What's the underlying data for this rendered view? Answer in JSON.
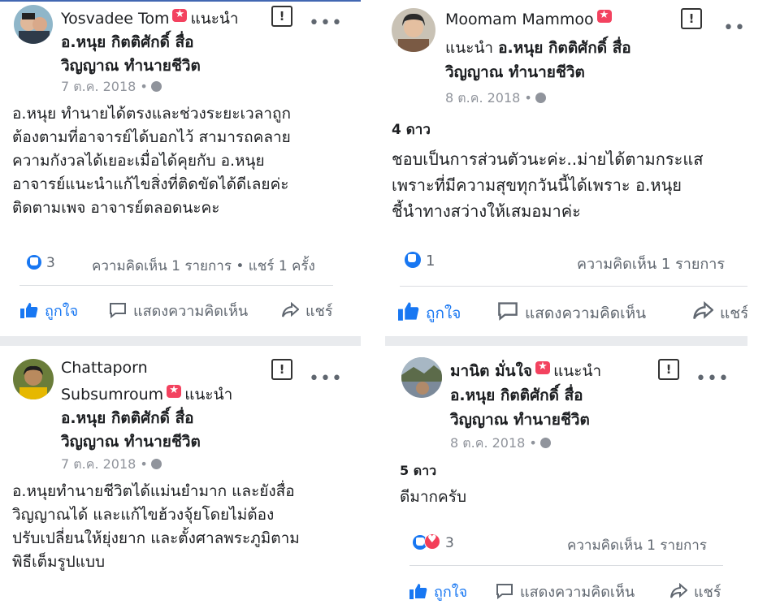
{
  "posts": [
    {
      "author": "Yosvadee Tom",
      "recommend_label": "แนะนำ",
      "page_line_1": "อ.หนุย กิตติศักดิ์ สื่อ",
      "page_line_2": "วิญญาณ ทำนายชีวิต",
      "date": "7 ต.ค. 2018 •",
      "stars": "",
      "body": [
        "อ.หนุย ทำนายได้ตรงและช่วงระยะเวลาถูก",
        "ต้องตามที่อาจารย์ได้บอกไว้ สามารถคลาย",
        "ความกังวลได้เยอะเมื่อได้คุยกับ อ.หนุย",
        "อาจารย์แนะนำแก้ไขสิ่งที่ติดขัดได้ดีเลยค่ะ",
        "ติดตามเพจ อาจารย์ตลอดนะคะ"
      ],
      "reaction_count": "3",
      "summary": "ความคิดเห็น 1 รายการ • แชร์ 1 ครั้ง",
      "like_label": "ถูกใจ",
      "comment_label": "แสดงความคิดเห็น",
      "share_label": "แชร์"
    },
    {
      "author": "Moomam Mammoo",
      "recommend_label": "แนะนำ",
      "page_line_1": "อ.หนุย กิตติศักดิ์ สื่อ",
      "page_line_2": "วิญญาณ ทำนายชีวิต",
      "date": "8 ต.ค. 2018 •",
      "stars": "4 ดาว",
      "body": [
        "ชอบเป็นการส่วนตัวนะค่ะ..ม่ายได้ตามกระแส",
        "เพราะที่มีความสุขทุกวันนี้ได้เพราะ อ.หนุย",
        "ชี้นำทางสว่างให้เสมอมาค่ะ"
      ],
      "reaction_count": "1",
      "summary": "ความคิดเห็น 1 รายการ",
      "like_label": "ถูกใจ",
      "comment_label": "แสดงความคิดเห็น",
      "share_label": "แชร์"
    },
    {
      "author_line_1": "Chattaporn",
      "author_line_2": "Subsumroum",
      "recommend_label": "แนะนำ",
      "page_line_1": "อ.หนุย กิตติศักดิ์ สื่อ",
      "page_line_2": "วิญญาณ ทำนายชีวิต",
      "date": "7 ต.ค. 2018 •",
      "body": [
        "อ.หนุยทำนายชีวิตได้แม่นยำมาก และยังสื่อ",
        "วิญญาณได้ และแก้ไขฮ้วงจุ้ยโดยไม่ต้อง",
        "ปรับเปลี่ยนให้ยุ่งยาก และตั้งศาลพระภูมิตาม",
        "พิธีเต็มรูปแบบ"
      ]
    },
    {
      "author": "มานิต มั่นใจ",
      "recommend_label": "แนะนำ",
      "page_line_1": "อ.หนุย กิตติศักดิ์ สื่อ",
      "page_line_2": "วิญญาณ ทำนายชีวิต",
      "date": "8 ต.ค. 2018 •",
      "stars": "5 ดาว",
      "body": [
        "ดีมากครับ"
      ],
      "reaction_count": "3",
      "summary": "ความคิดเห็น 1 รายการ",
      "like_label": "ถูกใจ",
      "comment_label": "แสดงความคิดเห็น",
      "share_label": "แชร์"
    }
  ],
  "colors": {
    "facebook_blue": "#1877f2",
    "recommend_red": "#f3425f",
    "muted_text": "#90949c",
    "separator": "#e9ebee"
  }
}
